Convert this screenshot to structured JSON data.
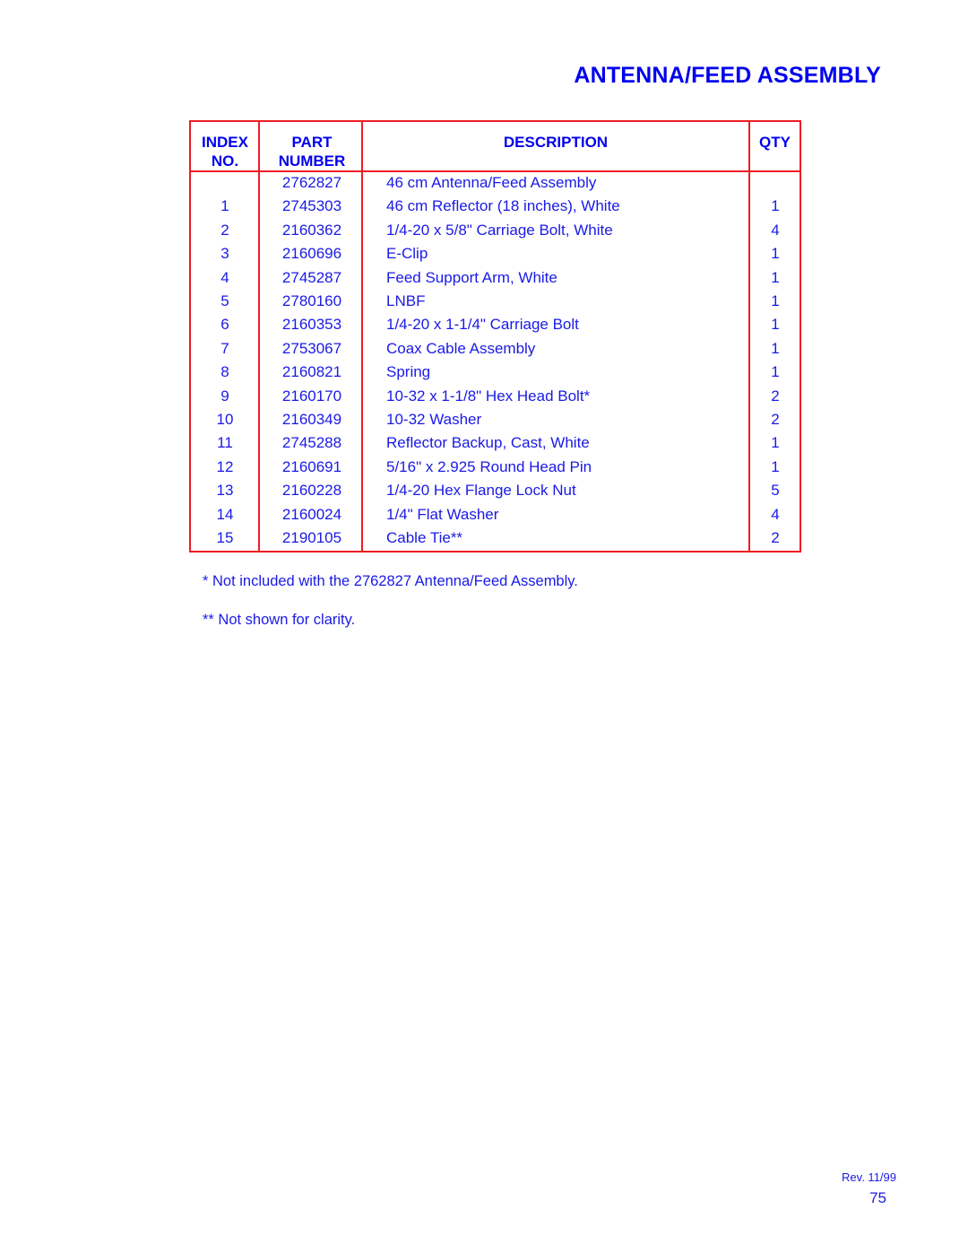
{
  "title": "ANTENNA/FEED ASSEMBLY",
  "table": {
    "headers": {
      "index": "INDEX",
      "index2": "NO.",
      "part": "PART",
      "part2": "NUMBER",
      "description": "DESCRIPTION",
      "qty": "QTY"
    },
    "rows": [
      {
        "index": "",
        "part": "2762827",
        "description": "46 cm Antenna/Feed Assembly",
        "qty": ""
      },
      {
        "index": "1",
        "part": "2745303",
        "description": "46 cm Reflector (18 inches), White",
        "qty": "1"
      },
      {
        "index": "2",
        "part": "2160362",
        "description": "1/4-20 x 5/8\" Carriage Bolt, White",
        "qty": "4"
      },
      {
        "index": "3",
        "part": "2160696",
        "description": "E-Clip",
        "qty": "1"
      },
      {
        "index": "4",
        "part": "2745287",
        "description": "Feed Support Arm, White",
        "qty": "1"
      },
      {
        "index": "5",
        "part": "2780160",
        "description": "LNBF",
        "qty": "1"
      },
      {
        "index": "6",
        "part": "2160353",
        "description": "1/4-20 x 1-1/4\" Carriage Bolt",
        "qty": "1"
      },
      {
        "index": "7",
        "part": "2753067",
        "description": "Coax Cable Assembly",
        "qty": "1"
      },
      {
        "index": "8",
        "part": "2160821",
        "description": "Spring",
        "qty": "1"
      },
      {
        "index": "9",
        "part": "2160170",
        "description": "10-32 x 1-1/8\" Hex Head Bolt*",
        "qty": "2"
      },
      {
        "index": "10",
        "part": "2160349",
        "description": "10-32 Washer",
        "qty": "2"
      },
      {
        "index": "11",
        "part": "2745288",
        "description": "Reflector Backup, Cast, White",
        "qty": "1"
      },
      {
        "index": "12",
        "part": "2160691",
        "description": "5/16\" x 2.925 Round Head Pin",
        "qty": "1"
      },
      {
        "index": "13",
        "part": "2160228",
        "description": "1/4-20 Hex Flange Lock Nut",
        "qty": "5"
      },
      {
        "index": "14",
        "part": "2160024",
        "description": "1/4\" Flat Washer",
        "qty": "4"
      },
      {
        "index": "15",
        "part": "2190105",
        "description": "Cable Tie**",
        "qty": "2"
      }
    ]
  },
  "notes": [
    "* Not included with the 2762827 Antenna/Feed Assembly.",
    "** Not shown for clarity."
  ],
  "footer": {
    "revision": "Rev. 11/99",
    "page_number": "75"
  },
  "colors": {
    "text": "#1a1ae6",
    "heading": "#0000ee",
    "rule": "#ee1c24"
  }
}
